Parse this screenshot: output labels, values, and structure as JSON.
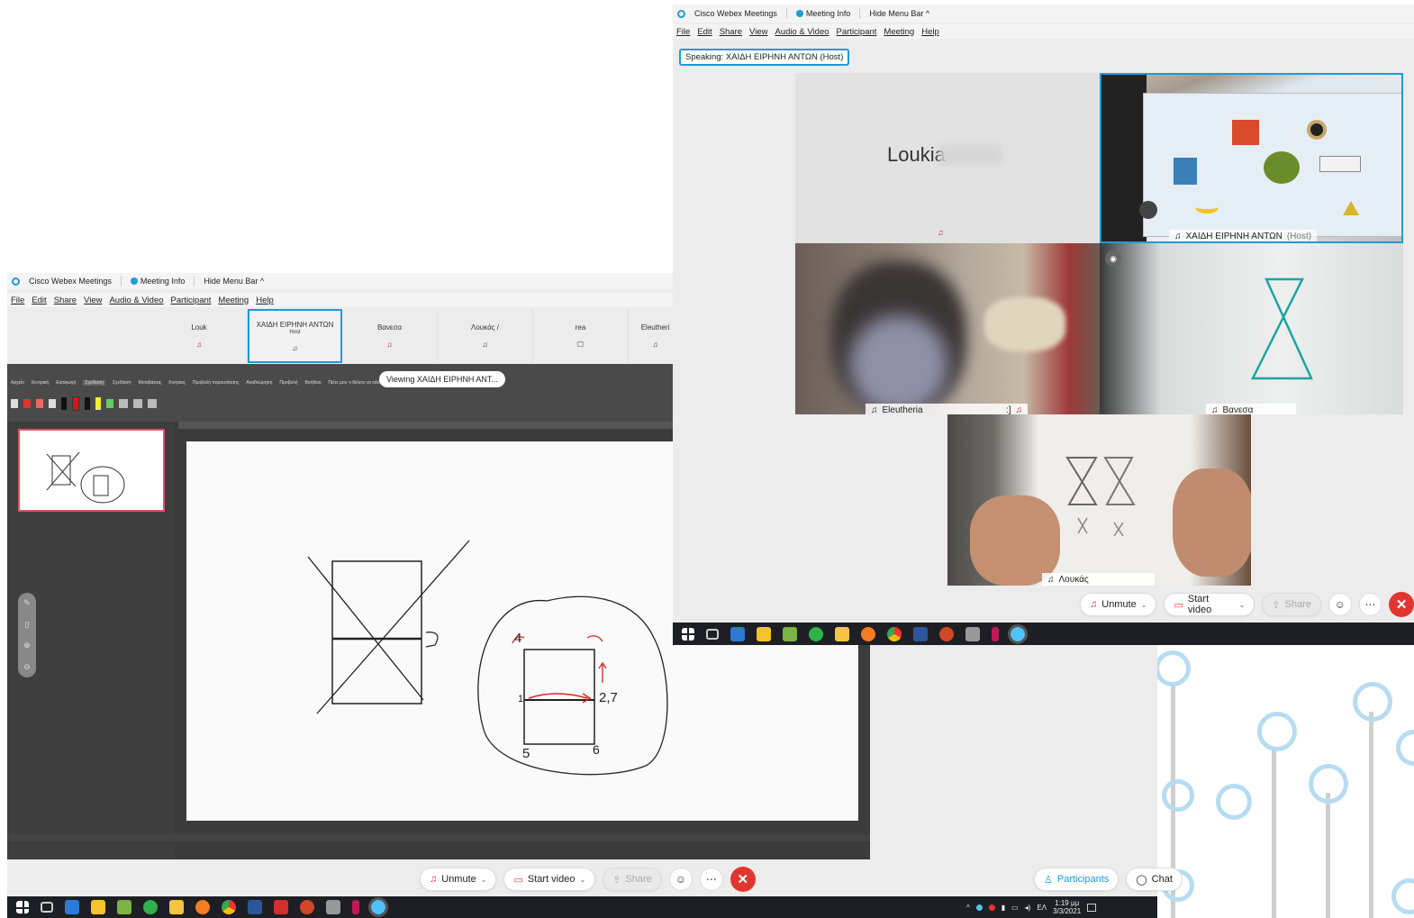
{
  "bg_window": {
    "titlebar": {
      "app": "Cisco Webex Meetings",
      "meeting_info": "Meeting Info",
      "hide_menu": "Hide Menu Bar ^"
    },
    "menu": [
      "File",
      "Edit",
      "Share",
      "View",
      "Audio & Video",
      "Participant",
      "Meeting",
      "Help"
    ],
    "thumbs": [
      {
        "name": "Louk",
        "sub": ""
      },
      {
        "name": "ΧΑΙΔΗ ΕΙΡΗΝΗ ΑΝΤΩΝ",
        "sub": "Host"
      },
      {
        "name": "Bανεσα",
        "sub": ""
      },
      {
        "name": "Λουκάς /",
        "sub": ""
      },
      {
        "name": "rea",
        "sub": ""
      },
      {
        "name": "Eleutheri",
        "sub": ""
      }
    ],
    "viewing_badge": "Viewing ΧΑΙΔΗ ΕΙΡΗΝΗ ΑΝΤ...",
    "ribbon_tabs": [
      "Αρχείο",
      "Κεντρική",
      "Εισαγωγή",
      "Σχεδίαση",
      "Σχεδίαση",
      "Μεταβάσεις",
      "Κινήσεις",
      "Προβολή παρουσίασης",
      "Αναθεώρηση",
      "Προβολή",
      "Βοήθεια"
    ],
    "ribbon_tell": "Πείτε μου τι θέλετε να κάνετε",
    "slide_numbers": {
      "n4": "4",
      "n3": "3",
      "n1": "1",
      "n27": "2,7",
      "n5": "5",
      "n6": "6",
      "n5b": "5"
    },
    "controls": {
      "unmute": "Unmute",
      "start_video": "Start video",
      "share": "Share",
      "participants": "Participants",
      "chat": "Chat"
    },
    "clock": {
      "time": "1:19 μμ",
      "date": "3/3/2021",
      "lang": "ΕΛ"
    }
  },
  "fg_window": {
    "titlebar": {
      "app": "Cisco Webex Meetings",
      "meeting_info": "Meeting Info",
      "hide_menu": "Hide Menu Bar ^"
    },
    "menu": [
      "File",
      "Edit",
      "Share",
      "View",
      "Audio & Video",
      "Participant",
      "Meeting",
      "Help"
    ],
    "speaking": "Speaking: ΧΑΙΔΗ ΕΙΡΗΝΗ ΑΝΤΩΝ (Host)",
    "tiles": {
      "loukia": {
        "name": "Loukia"
      },
      "host": {
        "name": "ΧΑΙΔΗ ΕΙΡΗΝΗ ΑΝΤΩΝ",
        "role": "(Host)"
      },
      "eleutheria": {
        "name": "Eleutheria",
        "emoji": ":]"
      },
      "vanesa": {
        "name": "Bανεσα"
      },
      "loukas": {
        "name": "Λουκάς"
      }
    },
    "controls": {
      "unmute": "Unmute",
      "start_video": "Start video",
      "share": "Share"
    }
  },
  "colors": {
    "accent": "#1d9bd6",
    "end": "#e0362f",
    "taskbar": "#1e1f24",
    "deco": "#b6dcf2"
  }
}
